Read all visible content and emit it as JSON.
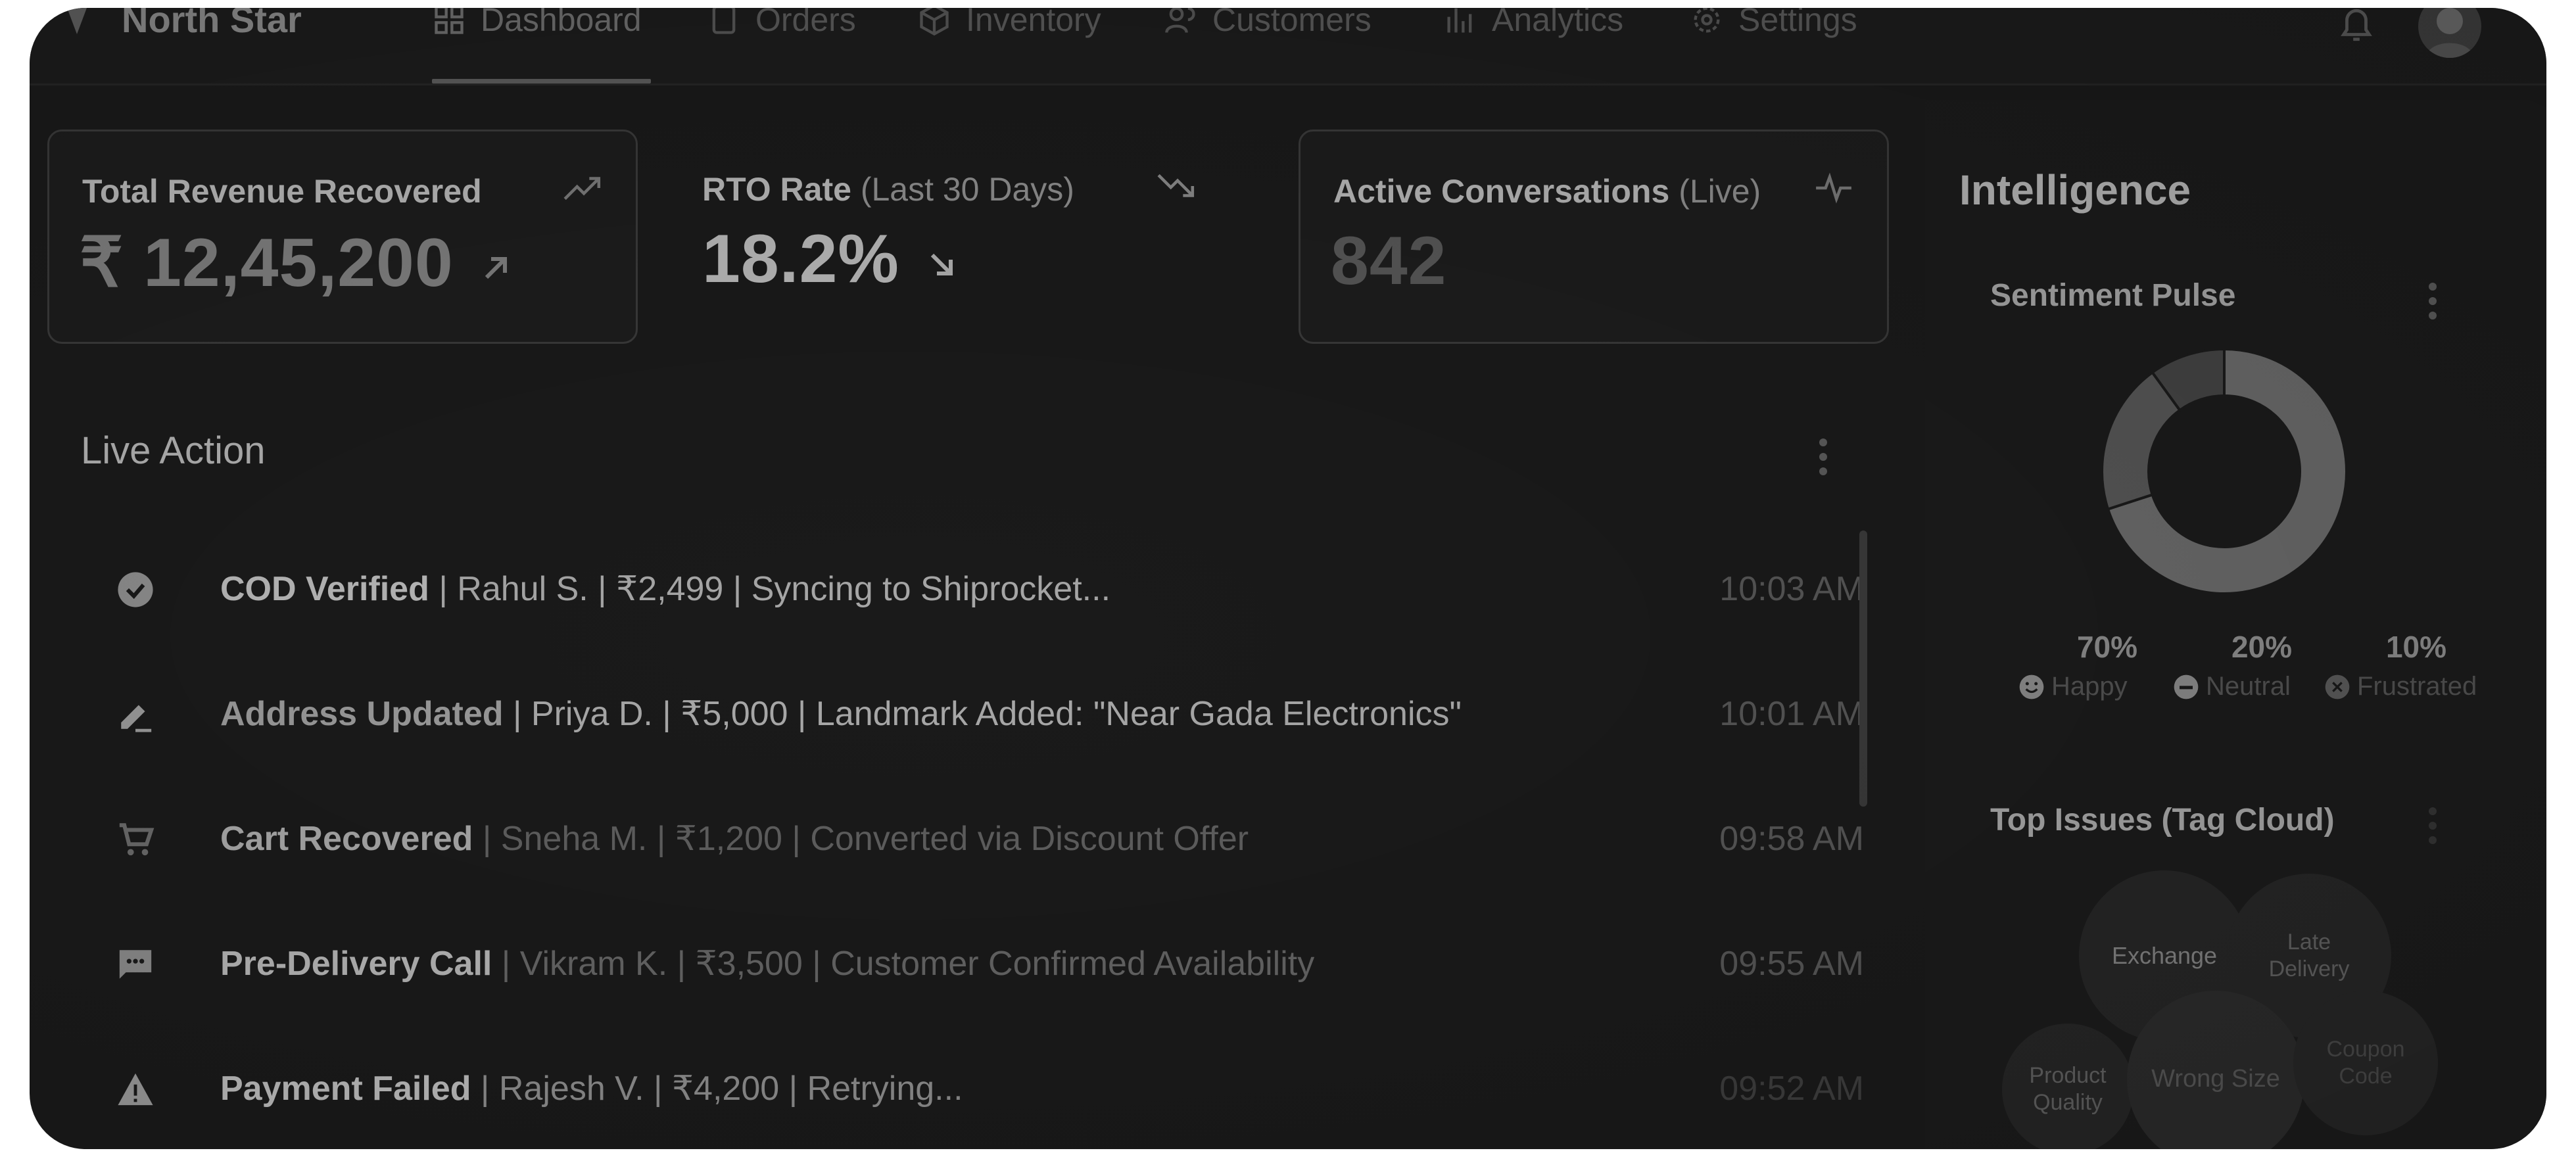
{
  "app": {
    "brand": "North Star"
  },
  "nav": {
    "items": [
      {
        "label": "Dashboard",
        "icon": "grid-icon",
        "active": true
      },
      {
        "label": "Orders",
        "icon": "clipboard-icon",
        "active": false
      },
      {
        "label": "Inventory",
        "icon": "box-icon",
        "active": false
      },
      {
        "label": "Customers",
        "icon": "users-icon",
        "active": false
      },
      {
        "label": "Analytics",
        "icon": "bar-chart-icon",
        "active": false
      },
      {
        "label": "Settings",
        "icon": "gear-icon",
        "active": false
      }
    ]
  },
  "stats": [
    {
      "title": "Total Revenue Recovered",
      "title_suffix": "",
      "value": "₹ 12,45,200",
      "trend_icon": "trend-up-icon"
    },
    {
      "title": "RTO Rate",
      "title_suffix": "(Last 30 Days)",
      "value": "18.2%",
      "trend_icon": "trend-down-icon"
    },
    {
      "title": "Active Conversations",
      "title_suffix": "(Live)",
      "value": "842",
      "trend_icon": "pulse-icon"
    }
  ],
  "live_action": {
    "title": "Live Action",
    "rows": [
      {
        "icon": "check-circle-icon",
        "event": "COD Verified",
        "details": " | Rahul S. | ₹2,499 | Syncing to Shiprocket...",
        "time": "10:03 AM"
      },
      {
        "icon": "edit-icon",
        "event": "Address Updated",
        "details": " | Priya D. | ₹5,000 | Landmark Added: \"Near Gada Electronics\"",
        "time": "10:01 AM"
      },
      {
        "icon": "cart-icon",
        "event": "Cart Recovered",
        "details": " | Sneha M. | ₹1,200 | Converted via Discount Offer",
        "time": "09:58 AM"
      },
      {
        "icon": "chat-icon",
        "event": "Pre-Delivery Call",
        "details": " | Vikram K. | ₹3,500 | Customer Confirmed Availability",
        "time": "09:55 AM"
      },
      {
        "icon": "warning-icon",
        "event": "Payment Failed",
        "details": " | Rajesh V. | ₹4,200 | Retrying...",
        "time": "09:52 AM"
      }
    ]
  },
  "intelligence": {
    "title": "Intelligence",
    "sentiment": {
      "title": "Sentiment Pulse",
      "segments": [
        {
          "pct": "70%",
          "label": "Happy",
          "value": 0.7,
          "icon": "smile-icon"
        },
        {
          "pct": "20%",
          "label": "Neutral",
          "value": 0.2,
          "icon": "minus-circle-icon"
        },
        {
          "pct": "10%",
          "label": "Frustrated",
          "value": 0.1,
          "icon": "x-circle-icon"
        }
      ]
    },
    "top_issues": {
      "title": "Top Issues (Tag Cloud)",
      "tags": [
        "Exchange",
        "Late Delivery",
        "Product Quality",
        "Wrong Size",
        "Coupon Code"
      ]
    }
  },
  "colors": {
    "background": "#1a1a1a",
    "card_border": "#3a3a3a",
    "text_primary": "#b7b7b7",
    "text_muted": "#565656"
  }
}
